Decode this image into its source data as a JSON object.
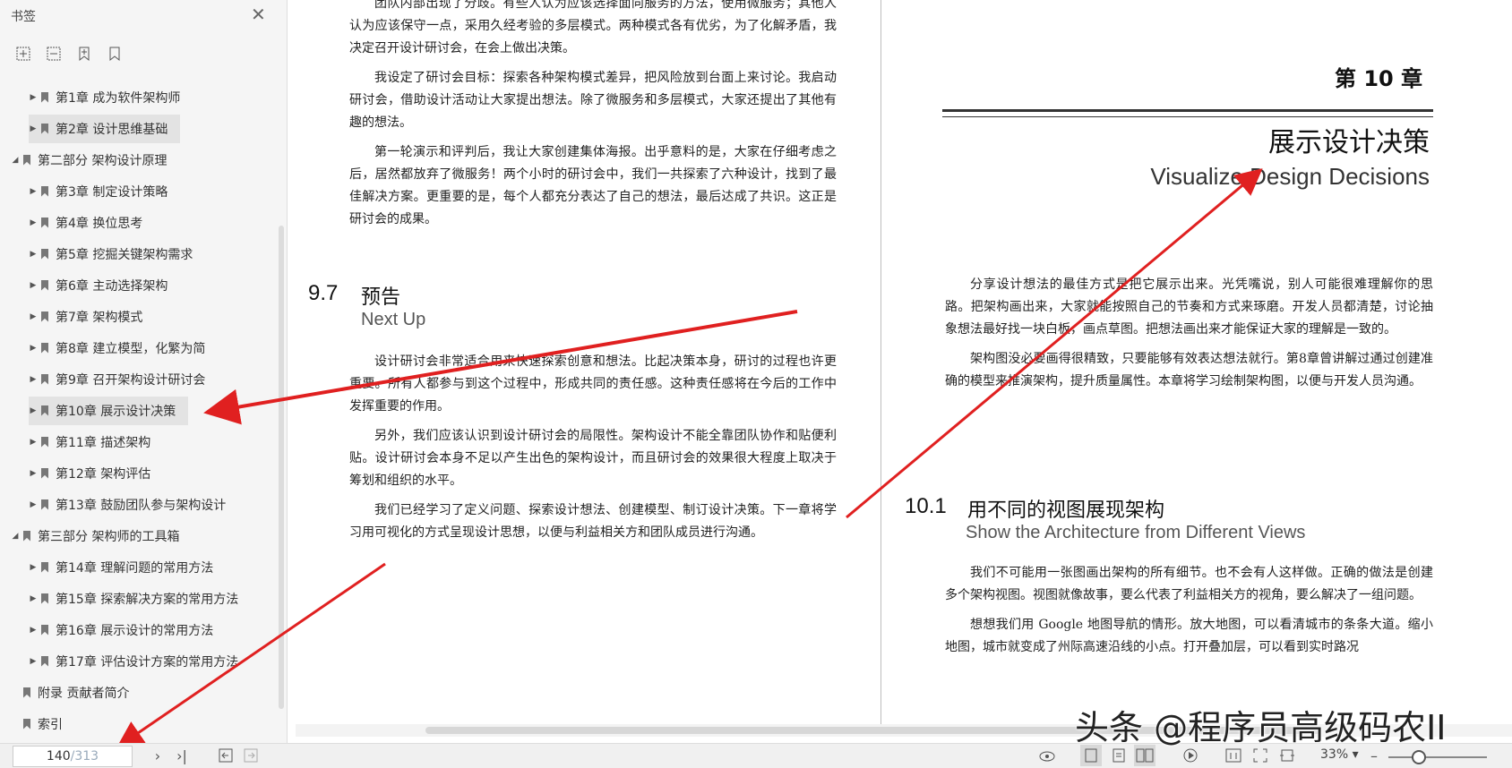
{
  "sidebar": {
    "title": "书签",
    "close": "✕",
    "tools": [
      "expand-all-icon",
      "collapse-all-icon",
      "add-bookmark-icon",
      "bookmark-icon"
    ],
    "items": [
      {
        "label": "第1章  成为软件架构师",
        "level": 1,
        "selected": false,
        "caret": "▶"
      },
      {
        "label": "第2章  设计思维基础",
        "level": 1,
        "selected": true,
        "caret": "▶"
      },
      {
        "label": "第二部分  架构设计原理",
        "level": 0,
        "selected": false,
        "caret": "◢"
      },
      {
        "label": "第3章  制定设计策略",
        "level": 1,
        "selected": false,
        "caret": "▶"
      },
      {
        "label": "第4章  换位思考",
        "level": 1,
        "selected": false,
        "caret": "▶"
      },
      {
        "label": "第5章  挖掘关键架构需求",
        "level": 1,
        "selected": false,
        "caret": "▶"
      },
      {
        "label": "第6章  主动选择架构",
        "level": 1,
        "selected": false,
        "caret": "▶"
      },
      {
        "label": "第7章  架构模式",
        "level": 1,
        "selected": false,
        "caret": "▶"
      },
      {
        "label": "第8章  建立模型，化繁为简",
        "level": 1,
        "selected": false,
        "caret": "▶"
      },
      {
        "label": "第9章  召开架构设计研讨会",
        "level": 1,
        "selected": false,
        "caret": "▶"
      },
      {
        "label": "第10章  展示设计决策",
        "level": 1,
        "selected": true,
        "caret": "▶"
      },
      {
        "label": "第11章  描述架构",
        "level": 1,
        "selected": false,
        "caret": "▶"
      },
      {
        "label": "第12章  架构评估",
        "level": 1,
        "selected": false,
        "caret": "▶"
      },
      {
        "label": "第13章  鼓励团队参与架构设计",
        "level": 1,
        "selected": false,
        "caret": "▶"
      },
      {
        "label": "第三部分  架构师的工具箱",
        "level": 0,
        "selected": false,
        "caret": "◢"
      },
      {
        "label": "第14章  理解问题的常用方法",
        "level": 1,
        "selected": false,
        "caret": "▶"
      },
      {
        "label": "第15章  探索解决方案的常用方法",
        "level": 1,
        "selected": false,
        "caret": "▶"
      },
      {
        "label": "第16章  展示设计的常用方法",
        "level": 1,
        "selected": false,
        "caret": "▶"
      },
      {
        "label": "第17章  评估设计方案的常用方法",
        "level": 1,
        "selected": false,
        "caret": "▶"
      },
      {
        "label": "附录  贡献者简介",
        "level": 0,
        "selected": false,
        "caret": ""
      },
      {
        "label": "索引",
        "level": 0,
        "selected": false,
        "caret": ""
      }
    ]
  },
  "left_page": {
    "top_paragraphs": [
      "团队内部出现了分歧。有些人认为应该选择面向服务的方法，使用微服务；其他人认为应该保守一点，采用久经考验的多层模式。两种模式各有优劣，为了化解矛盾，我决定召开设计研讨会，在会上做出决策。",
      "我设定了研讨会目标：探索各种架构模式差异，把风险放到台面上来讨论。我启动研讨会，借助设计活动让大家提出想法。除了微服务和多层模式，大家还提出了其他有趣的想法。",
      "第一轮演示和评判后，我让大家创建集体海报。出乎意料的是，大家在仔细考虑之后，居然都放弃了微服务！两个小时的研讨会中，我们一共探索了六种设计，找到了最佳解决方案。更重要的是，每个人都充分表达了自己的想法，最后达成了共识。这正是研讨会的成果。"
    ],
    "section_number": "9.7",
    "section_title": "预告",
    "section_subtitle": "Next Up",
    "bottom_paragraphs": [
      "设计研讨会非常适合用来快速探索创意和想法。比起决策本身，研讨的过程也许更重要。所有人都参与到这个过程中，形成共同的责任感。这种责任感将在今后的工作中发挥重要的作用。",
      "另外，我们应该认识到设计研讨会的局限性。架构设计不能全靠团队协作和贴便利贴。设计研讨会本身不足以产生出色的架构设计，而且研讨会的效果很大程度上取决于筹划和组织的水平。",
      "我们已经学习了定义问题、探索设计想法、创建模型、制订设计决策。下一章将学习用可视化的方式呈现设计思想，以便与利益相关方和团队成员进行沟通。"
    ]
  },
  "right_page": {
    "chapter_label": "第 10 章",
    "chapter_title": "展示设计决策",
    "chapter_subtitle": "Visualize Design Decisions",
    "intro_paragraphs": [
      "分享设计想法的最佳方式是把它展示出来。光凭嘴说，别人可能很难理解你的思路。把架构画出来，大家就能按照自己的节奏和方式来琢磨。开发人员都清楚，讨论抽象想法最好找一块白板，画点草图。把想法画出来才能保证大家的理解是一致的。",
      "架构图没必要画得很精致，只要能够有效表达想法就行。第8章曾讲解过通过创建准确的模型来推演架构，提升质量属性。本章将学习绘制架构图，以便与开发人员沟通。"
    ],
    "section_number": "10.1",
    "section_title": "用不同的视图展现架构",
    "section_subtitle": "Show the Architecture from Different Views",
    "section_paragraphs": [
      "我们不可能用一张图画出架构的所有细节。也不会有人这样做。正确的做法是创建多个架构视图。视图就像故事，要么代表了利益相关方的视角，要么解决了一组问题。",
      "想想我们用 Google 地图导航的情形。放大地图，可以看清城市的条条大道。缩小地图，城市就变成了州际高速沿线的小点。打开叠加层，可以看到实时路况"
    ]
  },
  "status": {
    "current_page": "140",
    "total_pages": "/313",
    "zoom": "33%",
    "zoom_fraction": 0.2
  },
  "watermark": "头条 @程序员高级码农II",
  "colors": {
    "arrow": "#e02020",
    "sidebar_bg": "#f5f5f5",
    "selected_bg": "#e3e3e3"
  }
}
